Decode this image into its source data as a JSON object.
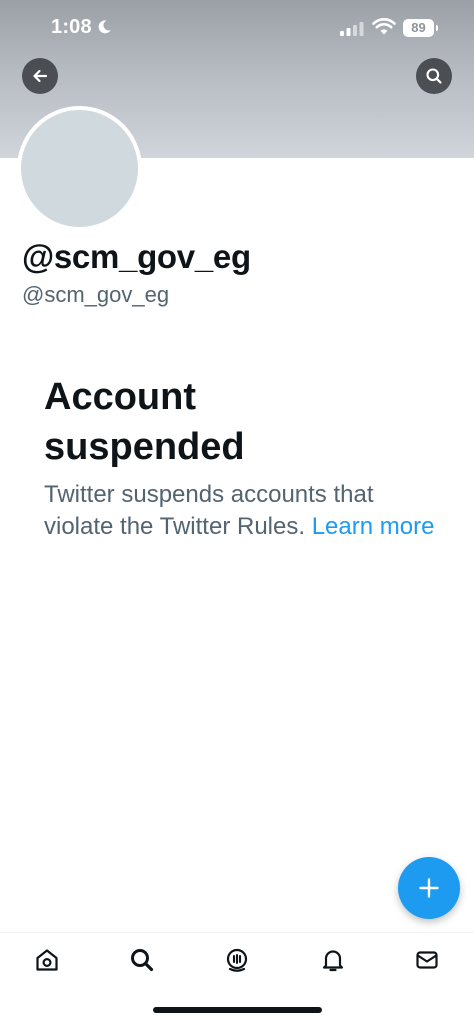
{
  "status_bar": {
    "time": "1:08",
    "battery": "89",
    "icons": [
      "moon-icon",
      "cellular-signal-icon",
      "wifi-icon",
      "battery-icon"
    ]
  },
  "header": {
    "banner_color": "#b5bbc1",
    "back_icon": "arrow-left-icon",
    "search_icon": "search-icon"
  },
  "profile": {
    "display_name": "@scm_gov_eg",
    "handle": "@scm_gov_eg"
  },
  "suspension": {
    "title": "Account suspended",
    "body": "Twitter suspends accounts that violate the Twitter Rules. ",
    "link": "Learn more"
  },
  "fab": {
    "icon": "plus-icon",
    "color": "#1d9bf0"
  },
  "tab_bar": {
    "tabs": [
      "home-icon",
      "search-icon",
      "spaces-icon",
      "notifications-icon",
      "messages-icon"
    ]
  },
  "colors": {
    "accent": "#1d9bf0",
    "text_primary": "#0f1419",
    "text_secondary": "#536471"
  }
}
